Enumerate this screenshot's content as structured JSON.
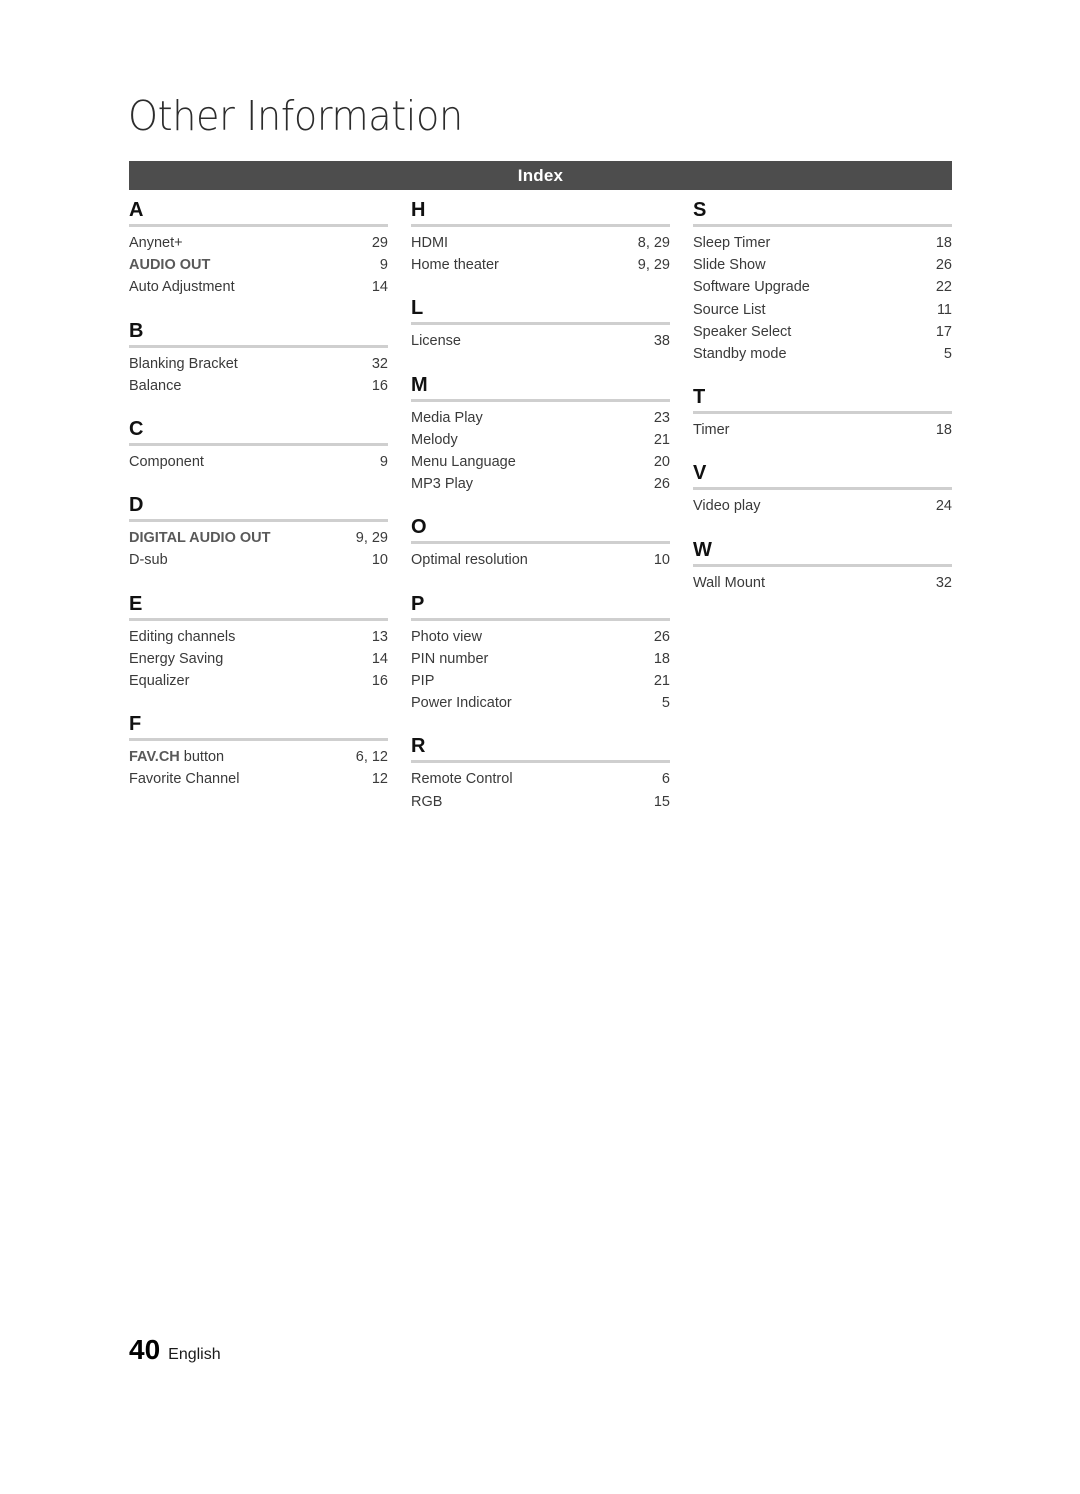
{
  "chapter": {
    "title": "Other Information"
  },
  "index": {
    "bar_label": "Index",
    "bar_color": "#4d4d4d",
    "rule_color": "#cfcfcf",
    "columns": [
      {
        "sections": [
          {
            "letter": "A",
            "entries": [
              {
                "label": "Anynet+",
                "page": "29",
                "bold": false
              },
              {
                "label": "AUDIO OUT",
                "page": "9",
                "bold": true
              },
              {
                "label": "Auto Adjustment",
                "page": "14",
                "bold": false
              }
            ]
          },
          {
            "letter": "B",
            "entries": [
              {
                "label": "Blanking Bracket",
                "page": "32",
                "bold": false
              },
              {
                "label": "Balance",
                "page": "16",
                "bold": false
              }
            ]
          },
          {
            "letter": "C",
            "entries": [
              {
                "label": "Component",
                "page": "9",
                "bold": false
              }
            ]
          },
          {
            "letter": "D",
            "entries": [
              {
                "label": "DIGITAL AUDIO OUT",
                "page": "9, 29",
                "bold": true
              },
              {
                "label": "D-sub",
                "page": "10",
                "bold": false
              }
            ]
          },
          {
            "letter": "E",
            "entries": [
              {
                "label": "Editing channels",
                "page": "13",
                "bold": false
              },
              {
                "label": "Energy Saving",
                "page": "14",
                "bold": false
              },
              {
                "label": "Equalizer",
                "page": "16",
                "bold": false
              }
            ]
          },
          {
            "letter": "F",
            "entries": [
              {
                "label": "FAV.CH",
                "suffix": " button",
                "page": "6, 12",
                "bold": true
              },
              {
                "label": "Favorite Channel",
                "page": "12",
                "bold": false
              }
            ]
          }
        ]
      },
      {
        "sections": [
          {
            "letter": "H",
            "entries": [
              {
                "label": "HDMI",
                "page": "8, 29",
                "bold": false
              },
              {
                "label": "Home theater",
                "page": "9, 29",
                "bold": false
              }
            ]
          },
          {
            "letter": "L",
            "entries": [
              {
                "label": "License",
                "page": "38",
                "bold": false
              }
            ]
          },
          {
            "letter": "M",
            "entries": [
              {
                "label": "Media Play",
                "page": "23",
                "bold": false
              },
              {
                "label": "Melody",
                "page": "21",
                "bold": false
              },
              {
                "label": "Menu Language",
                "page": "20",
                "bold": false
              },
              {
                "label": "MP3 Play",
                "page": "26",
                "bold": false
              }
            ]
          },
          {
            "letter": "O",
            "entries": [
              {
                "label": "Optimal resolution",
                "page": "10",
                "bold": false
              }
            ]
          },
          {
            "letter": "P",
            "entries": [
              {
                "label": "Photo view",
                "page": "26",
                "bold": false
              },
              {
                "label": "PIN number",
                "page": "18",
                "bold": false
              },
              {
                "label": "PIP",
                "page": "21",
                "bold": false
              },
              {
                "label": "Power Indicator",
                "page": "5",
                "bold": false
              }
            ]
          },
          {
            "letter": "R",
            "entries": [
              {
                "label": "Remote Control",
                "page": "6",
                "bold": false
              },
              {
                "label": "RGB",
                "page": "15",
                "bold": false
              }
            ]
          }
        ]
      },
      {
        "sections": [
          {
            "letter": "S",
            "entries": [
              {
                "label": "Sleep Timer",
                "page": "18",
                "bold": false
              },
              {
                "label": "Slide Show",
                "page": "26",
                "bold": false
              },
              {
                "label": "Software Upgrade",
                "page": "22",
                "bold": false
              },
              {
                "label": "Source List",
                "page": "11",
                "bold": false
              },
              {
                "label": "Speaker Select",
                "page": "17",
                "bold": false
              },
              {
                "label": "Standby mode",
                "page": "5",
                "bold": false
              }
            ]
          },
          {
            "letter": "T",
            "entries": [
              {
                "label": "Timer",
                "page": "18",
                "bold": false
              }
            ]
          },
          {
            "letter": "V",
            "entries": [
              {
                "label": "Video play",
                "page": "24",
                "bold": false
              }
            ]
          },
          {
            "letter": "W",
            "entries": [
              {
                "label": "Wall Mount",
                "page": "32",
                "bold": false
              }
            ]
          }
        ]
      }
    ]
  },
  "footer": {
    "page_number": "40",
    "language": "English"
  }
}
